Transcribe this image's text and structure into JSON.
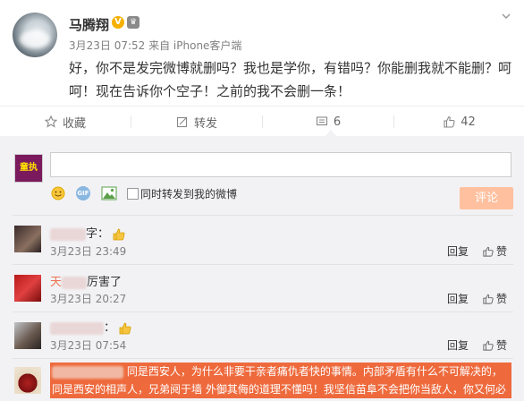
{
  "post": {
    "author": "马腾翔",
    "v_badge": "V",
    "meta": "3月23日 07:52 来自 iPhone客户端",
    "text": "好，你不是发完微博就删吗？我也是学你，有错吗？你能删我就不能删？呵呵！现在告诉你个空子！之前的我不会删一条！"
  },
  "actions": {
    "favorite": "收藏",
    "repost": "转发",
    "comment_count": "6",
    "like_count": "42"
  },
  "composer": {
    "avatar_text": "童执",
    "checkbox_label": "同时转发到我的微博",
    "submit_label": "评论"
  },
  "comments": [
    {
      "text_suffix": "字：",
      "time": "3月23日 23:49",
      "reply": "回复",
      "like": "赞"
    },
    {
      "name_prefix": "天",
      "text": "厉害了",
      "time": "3月23日 20:27",
      "reply": "回复",
      "like": "赞"
    },
    {
      "text_suffix": "：",
      "time": "3月23日 07:54",
      "reply": "回复",
      "like": "赞"
    },
    {
      "highlight_line1": "同是西安人，为什么非要干亲者痛仇者快的事情。内部矛盾有什么不可解决的，",
      "highlight_line2": "同是西安的相声人，兄弟阋于墙 外御其侮的道理不懂吗！我坚信苗阜不会把你当敌人，你又何必"
    }
  ],
  "colors": {
    "accent_orange": "#ee6a3d",
    "submit_bg": "#ffc09f",
    "comment_bg": "#f2f2f5",
    "verified": "#f6b100"
  }
}
